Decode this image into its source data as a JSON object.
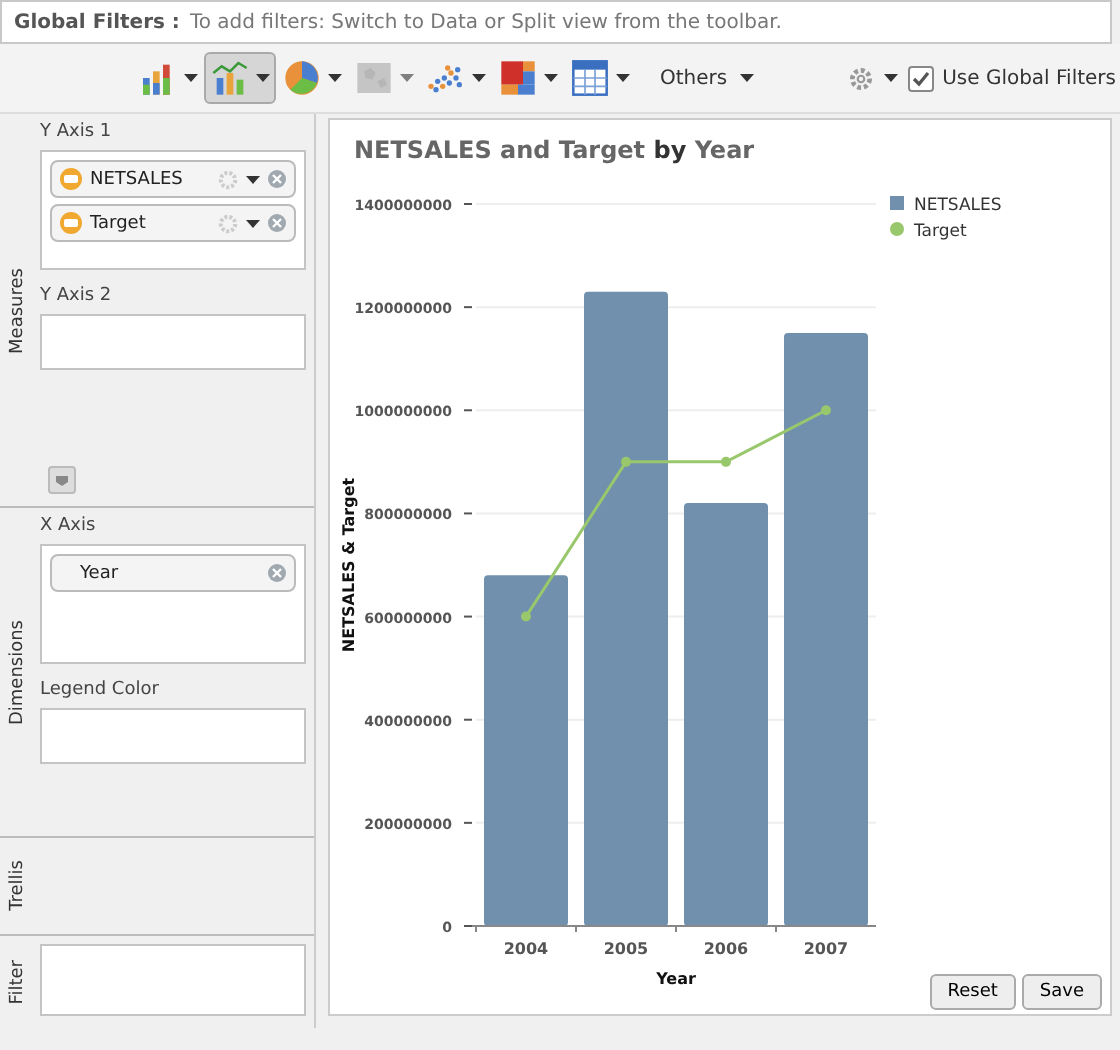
{
  "global_filters": {
    "label": "Global Filters :",
    "hint": "To add filters: Switch to Data or Split view from the toolbar."
  },
  "toolbar": {
    "chart_types": [
      {
        "kind": "bar",
        "selected": false,
        "disabled": false
      },
      {
        "kind": "combo",
        "selected": true,
        "disabled": false
      },
      {
        "kind": "pie",
        "selected": false,
        "disabled": false
      },
      {
        "kind": "geo",
        "selected": false,
        "disabled": true
      },
      {
        "kind": "scatter",
        "selected": false,
        "disabled": false
      },
      {
        "kind": "treemap",
        "selected": false,
        "disabled": false
      },
      {
        "kind": "table",
        "selected": false,
        "disabled": false
      }
    ],
    "others": "Others",
    "use_global_filters": {
      "label": "Use Global Filters",
      "checked": true
    }
  },
  "sidebar": {
    "sections": [
      {
        "title": "Measures",
        "kind": "axes",
        "wells": [
          {
            "label": "Y Axis 1",
            "chips": [
              {
                "label": "NETSALES",
                "kind": "measure"
              },
              {
                "label": "Target",
                "kind": "measure"
              }
            ]
          },
          {
            "label": "Y Axis 2"
          }
        ]
      },
      {
        "title": "Dimensions",
        "kind": "axes",
        "wells": [
          {
            "label": "X Axis",
            "chips": [
              {
                "label": "Year",
                "kind": "dimension"
              }
            ]
          },
          {
            "label": "Legend Color"
          }
        ]
      },
      {
        "title": "Trellis",
        "kind": "axes"
      },
      {
        "title": "Filter",
        "kind": "filter"
      }
    ]
  },
  "chart": {
    "title": "NETSALES and Target",
    "title_by": "by",
    "title_dim": "Year",
    "chart_data": {
      "type": "bar",
      "xlabel": "Year",
      "ylabel": "NETSALES & Target",
      "categories": [
        "2004",
        "2005",
        "2006",
        "2007"
      ],
      "series": [
        {
          "name": "NETSALES",
          "type": "bar",
          "color": "#7090ad",
          "values": [
            680000000,
            1230000000,
            820000000,
            1150000000
          ]
        },
        {
          "name": "Target",
          "type": "line",
          "marker": "circle",
          "color": "#99c76c",
          "values": [
            600000000,
            900000000,
            900000000,
            1000000000
          ]
        }
      ],
      "grid": true,
      "legend": true,
      "ylim": [
        0,
        1400000000
      ],
      "yticks": [
        0,
        200000000,
        400000000,
        600000000,
        800000000,
        1000000000,
        1200000000,
        1400000000
      ]
    }
  },
  "buttons": [
    "Reset",
    "Save"
  ]
}
